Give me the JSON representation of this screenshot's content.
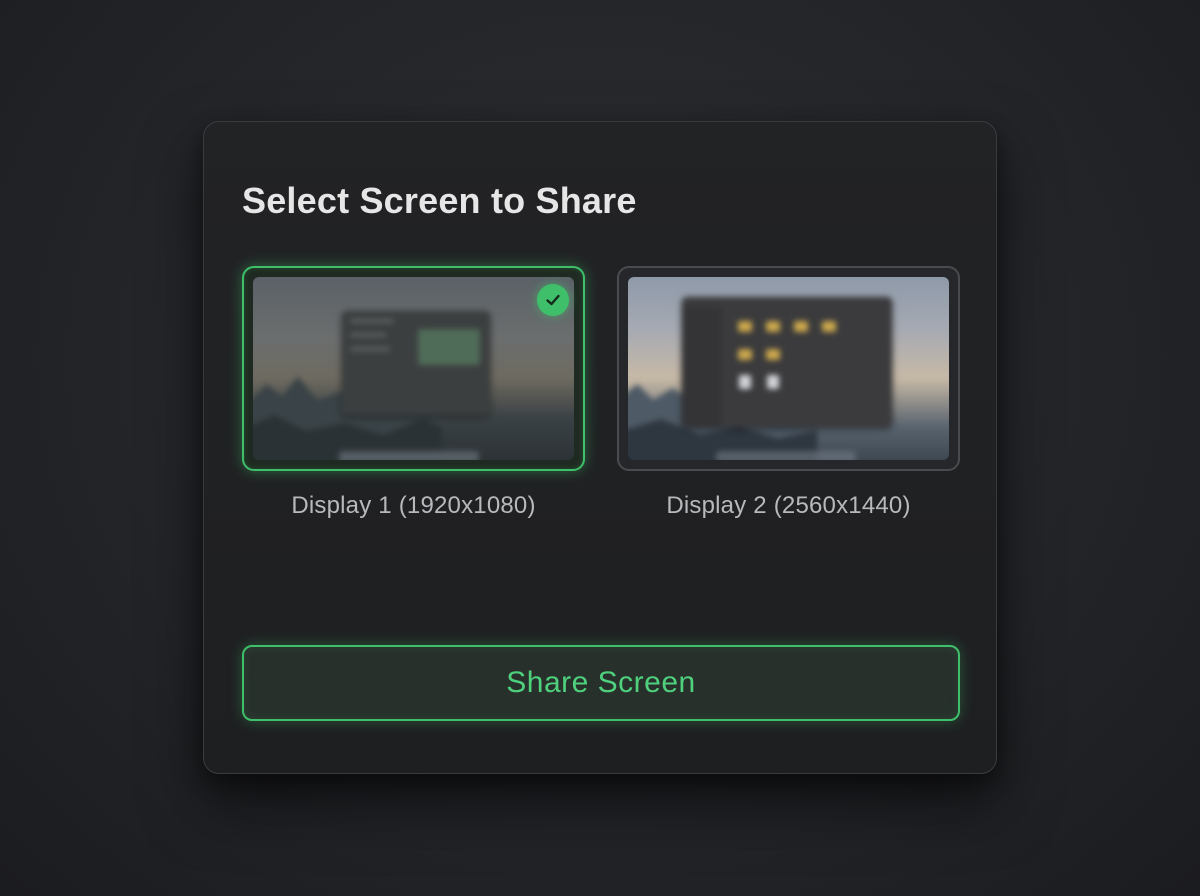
{
  "dialog": {
    "title": "Select Screen to Share",
    "displays": [
      {
        "label": "Display 1 (1920x1080)",
        "selected": true,
        "selected_icon": "checkmark-icon"
      },
      {
        "label": "Display 2 (2560x1440)",
        "selected": false
      }
    ],
    "share_button_label": "Share Screen"
  },
  "colors": {
    "accent": "#3fbf6a",
    "accent_text": "#4ed07d",
    "dialog_bg": "#1f2022",
    "page_bg": "#25272b"
  }
}
